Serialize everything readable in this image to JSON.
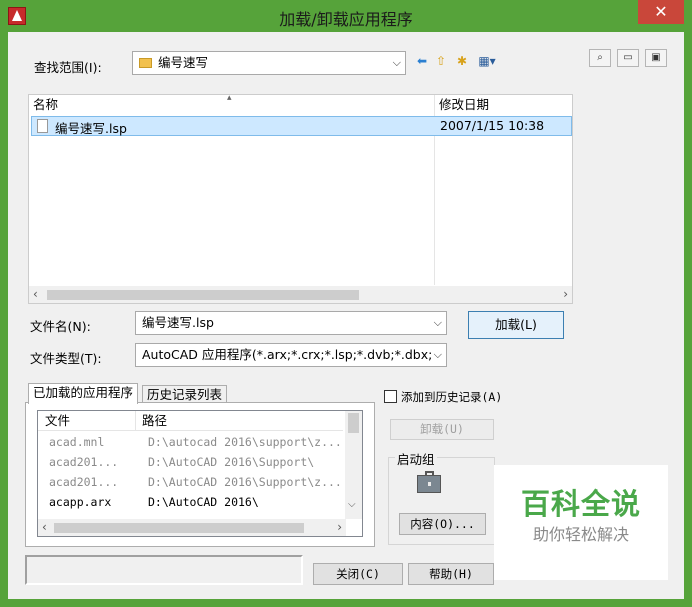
{
  "window": {
    "title": "加载/卸载应用程序",
    "close_glyph": "✕"
  },
  "lookin": {
    "label": "查找范围(I):",
    "value": "编号速写"
  },
  "columns": {
    "name": "名称",
    "modified": "修改日期"
  },
  "files": [
    {
      "name": "编号速写.lsp",
      "modified": "2007/1/15 10:38"
    }
  ],
  "filename": {
    "label": "文件名(N):",
    "value": "编号速写.lsp"
  },
  "filetype": {
    "label": "文件类型(T):",
    "value": "AutoCAD 应用程序(*.arx;*.crx;*.lsp;*.dvb;*.dbx;"
  },
  "buttons": {
    "load": "加载(L)",
    "unload": "卸载(U)",
    "contents": "内容(O)...",
    "close": "关闭(C)",
    "help": "帮助(H)"
  },
  "tabs": {
    "loaded": "已加载的应用程序",
    "history": "历史记录列表"
  },
  "app_list": {
    "col_file": "文件",
    "col_path": "路径",
    "rows": [
      {
        "file": "acad.mnl",
        "path": "D:\\autocad 2016\\support\\z...",
        "greyed": true
      },
      {
        "file": "acad201...",
        "path": "D:\\AutoCAD 2016\\Support\\",
        "greyed": true
      },
      {
        "file": "acad201...",
        "path": "D:\\AutoCAD 2016\\Support\\z...",
        "greyed": true
      },
      {
        "file": "acapp.arx",
        "path": "D:\\AutoCAD 2016\\",
        "greyed": false
      }
    ]
  },
  "history_checkbox": {
    "label": "添加到历史记录(A)",
    "checked": false
  },
  "startup_group": {
    "label": "启动组"
  },
  "watermark": {
    "title": "百科全说",
    "subtitle": "助你轻松解决"
  },
  "colors": {
    "title_bar": "#56a33a",
    "close_button": "#c9473a",
    "selection": "#cde8ff",
    "watermark_green": "#4aa84a"
  }
}
